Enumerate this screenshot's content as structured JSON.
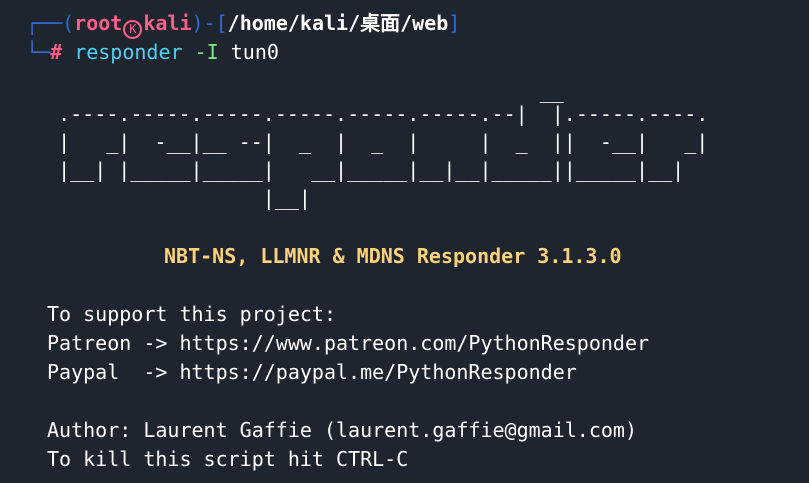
{
  "prompt": {
    "box_top_left": "┌──",
    "open_paren": "(",
    "user": "root",
    "skull_symbol": "K",
    "host": "kali",
    "close_paren": ")",
    "separator": "-[",
    "path": "/home/kali/桌面/web",
    "close_bracket": "]",
    "box_bottom_left": "└─",
    "hash": "# "
  },
  "command": {
    "program": "responder",
    "flag": "-I",
    "arg": "tun0"
  },
  "banner": {
    "line1": "                                          __",
    "line2": "  .----.-----.-----.-----.-----.-----.--|  |.-----.----.",
    "line3": "  |   _|  -__|__ --|  _  |  _  |     |  _  ||  -__|   _|",
    "line4": "  |__| |_____|_____|   __|_____|__|__|_____||_____|__|",
    "line5": "                   |__|"
  },
  "title": "NBT-NS, LLMNR & MDNS Responder 3.1.3.0",
  "support": {
    "heading": "To support this project:",
    "patreon": "Patreon -> https://www.patreon.com/PythonResponder",
    "paypal": "Paypal  -> https://paypal.me/PythonResponder"
  },
  "author": "Author: Laurent Gaffie (laurent.gaffie@gmail.com)",
  "kill_hint": "To kill this script hit CTRL-C",
  "colors": {
    "background": "#1e252e",
    "box_lines": "#2f6bd9",
    "user_host": "#ff5f87",
    "command": "#4fd0f0",
    "flag": "#7ee787",
    "title": "#ffd27a"
  }
}
